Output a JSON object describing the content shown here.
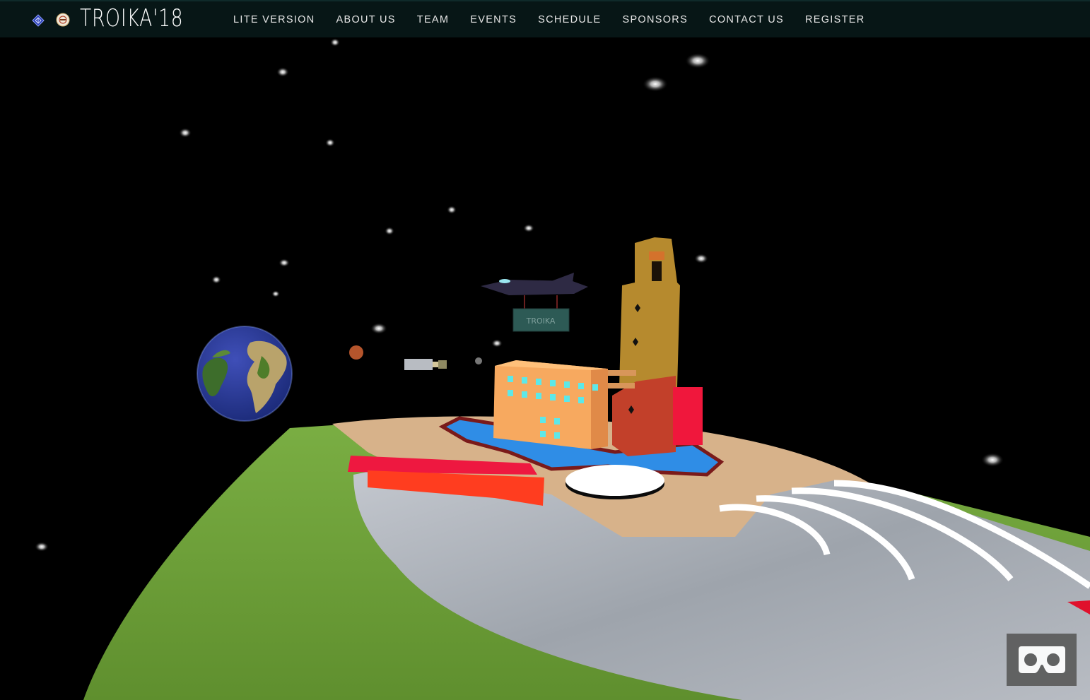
{
  "header": {
    "logo_text": "TROIKA'18",
    "nav": [
      {
        "label": "LITE VERSION"
      },
      {
        "label": "ABOUT US"
      },
      {
        "label": "TEAM"
      },
      {
        "label": "EVENTS"
      },
      {
        "label": "SCHEDULE"
      },
      {
        "label": "SPONSORS"
      },
      {
        "label": "CONTACT US"
      },
      {
        "label": "REGISTER"
      }
    ]
  },
  "scene": {
    "banner_text": "TROIKA"
  },
  "icons": {
    "brand_icon_1": "diamond-logo-icon",
    "brand_icon_2": "emblem-logo-icon",
    "vr": "vr-headset-icon"
  },
  "colors": {
    "nav_background": "#071616",
    "nav_text": "#e6e6e6",
    "space": "#000000",
    "grass": "#6e9e3a",
    "tower": "#b68a2e",
    "building": "#f7a95f",
    "water": "#2f8de6",
    "red_block": "#f0173c"
  }
}
